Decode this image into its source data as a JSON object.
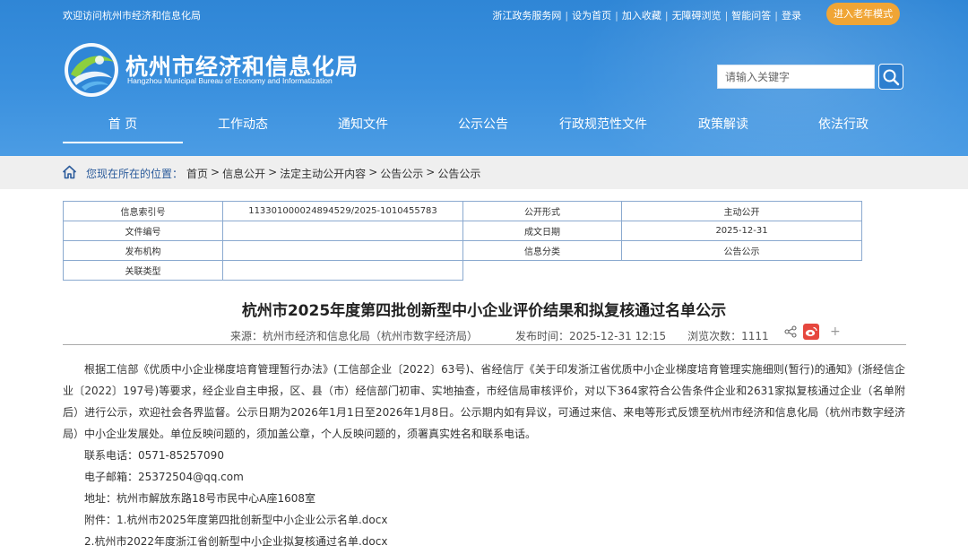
{
  "header": {
    "welcome": "欢迎访问杭州市经济和信息化局",
    "top_links": [
      "浙江政务服务网",
      "设为首页",
      "加入收藏",
      "无障碍浏览",
      "智能问答",
      "登录"
    ],
    "elder_mode": "进入老年模式",
    "site_title": "杭州市经济和信息化局",
    "site_subtitle": "Hangzhou Municipal Bureau of Economy and Informatization",
    "search_placeholder": "请输入关键字"
  },
  "nav": {
    "items": [
      "首 页",
      "工作动态",
      "通知文件",
      "公示公告",
      "行政规范性文件",
      "政策解读",
      "依法行政"
    ],
    "active": "首 页"
  },
  "breadcrumb": {
    "lead": "您现在所在的位置：",
    "items": [
      "首页",
      "信息公开",
      "法定主动公开内容",
      "公告公示",
      "公告公示"
    ]
  },
  "info_table": {
    "index_label": "信息索引号",
    "index_value": "113301000024894529/2025-1010455783",
    "form_label": "公开形式",
    "form_value": "主动公开",
    "docno_label": "文件编号",
    "docno_value": "",
    "date_label": "成文日期",
    "date_value": "2025-12-31",
    "org_label": "发布机构",
    "org_value": "",
    "category_label": "信息分类",
    "category_value": "公告公示",
    "type_label": "关联类型",
    "type_value": ""
  },
  "article": {
    "title": "杭州市2025年度第四批创新型中小企业评价结果和拟复核通过名单公示",
    "source": "来源：杭州市经济和信息化局（杭州市数字经济局）",
    "published": "发布时间：2025-12-31 12:15",
    "views": "浏览次数：1111",
    "paragraph": "根据工信部《优质中小企业梯度培育管理暂行办法》(工信部企业〔2022〕63号)、省经信厅《关于印发浙江省优质中小企业梯度培育管理实施细则(暂行)的通知》(浙经信企业〔2022〕197号)等要求，经企业自主申报，区、县（市）经信部门初审、实地抽查，市经信局审核评价，对以下364家符合公告条件企业和2631家拟复核通过企业（名单附后）进行公示，欢迎社会各界监督。公示日期为2026年1月1日至2026年1月8日。公示期内如有异议，可通过来信、来电等形式反馈至杭州市经济和信息化局（杭州市数字经济局）中小企业发展处。单位反映问题的，须加盖公章，个人反映问题的，须署真实姓名和联系电话。",
    "phone": "联系电话：0571-85257090",
    "email": "电子邮箱：25372504@qq.com",
    "address": "地址：杭州市解放东路18号市民中心A座1608室",
    "attachment1": "附件：1.杭州市2025年度第四批创新型中小企业公示名单.docx",
    "attachment2": "2.杭州市2022年度浙江省创新型中小企业拟复核通过名单.docx"
  },
  "colors": {
    "header_blue": "#3a8fde",
    "elder_orange": "#f0a535",
    "weibo_red": "#e6473e",
    "table_border": "#8aa9cf"
  }
}
